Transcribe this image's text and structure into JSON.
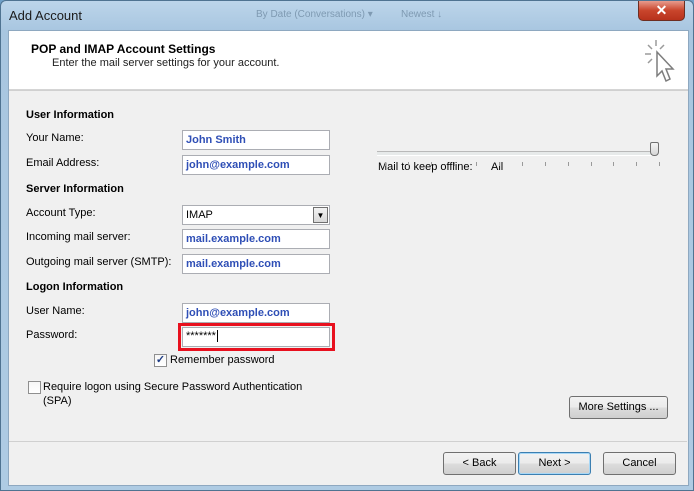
{
  "window": {
    "title": "Add Account",
    "ghost_left": "By Date (Conversations) ▾",
    "ghost_right": "Newest ↓",
    "close_glyph": "✕"
  },
  "header": {
    "title": "POP and IMAP Account Settings",
    "subtitle": "Enter the mail server settings for your account.",
    "icon": "wizard-cursor-icon"
  },
  "user_info": {
    "heading": "User Information",
    "name_label": "Your Name:",
    "name_value": "John Smith",
    "email_label": "Email Address:",
    "email_value": "john@example.com"
  },
  "server_info": {
    "heading": "Server Information",
    "account_type_label": "Account Type:",
    "account_type_value": "IMAP",
    "incoming_label": "Incoming mail server:",
    "incoming_value": "mail.example.com",
    "outgoing_label": "Outgoing mail server (SMTP):",
    "outgoing_value": "mail.example.com"
  },
  "logon_info": {
    "heading": "Logon Information",
    "username_label": "User Name:",
    "username_value": "john@example.com",
    "password_label": "Password:",
    "password_value": "*******",
    "remember_label": "Remember password",
    "remember_checked": true,
    "spa_label_line1": "Require logon using Secure Password Authentication",
    "spa_label_line2": "(SPA)",
    "spa_checked": false
  },
  "offline": {
    "label": "Mail to keep offline:",
    "value": "All",
    "slider_fraction": 1.0
  },
  "buttons": {
    "more_settings": "More Settings ...",
    "back": "< Back",
    "next": "Next >",
    "cancel": "Cancel"
  },
  "colors": {
    "field_text": "#2f4fb6",
    "highlight": "#e8101e",
    "close_button": "#c9452c"
  }
}
